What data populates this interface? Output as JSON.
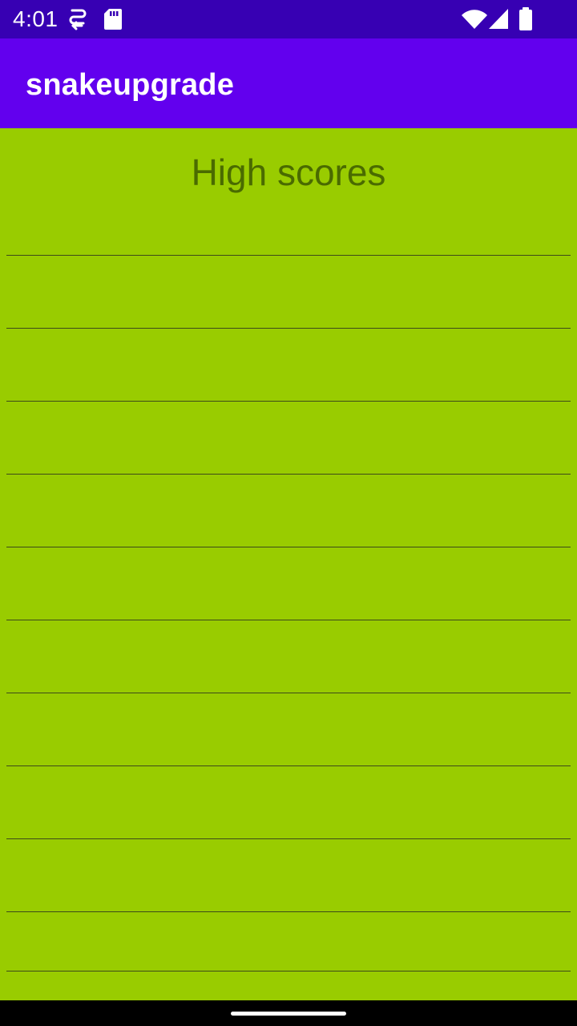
{
  "status_bar": {
    "time": "4:01",
    "icons": [
      "sync-icon",
      "sd-card-icon",
      "wifi-icon",
      "signal-icon",
      "battery-icon"
    ]
  },
  "app_bar": {
    "title": "snakeupgrade"
  },
  "high_scores": {
    "heading": "High scores",
    "rows": [
      "",
      "",
      "",
      "",
      "",
      "",
      "",
      "",
      "",
      "",
      ""
    ]
  },
  "colors": {
    "status_bar": "#3700b3",
    "app_bar": "#6200ee",
    "background": "#99cc00",
    "heading_text": "#4a6b00",
    "divider": "#3d4a1a"
  }
}
